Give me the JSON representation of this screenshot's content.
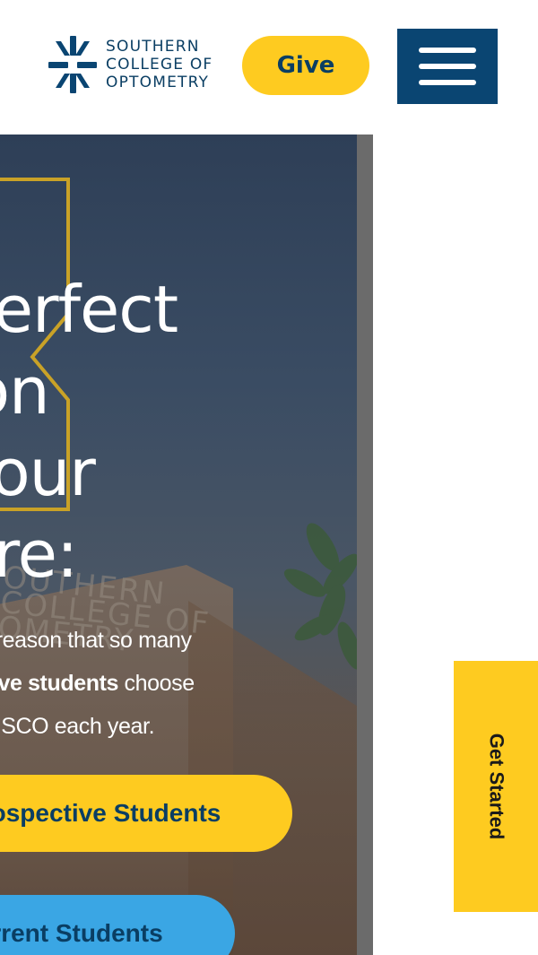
{
  "header": {
    "logo_lines": [
      "SOUTHERN",
      "COLLEGE OF",
      "OPTOMETRY"
    ],
    "give_label": "Give",
    "menu_icon": "hamburger-menu-icon"
  },
  "hero": {
    "headline_lines": [
      "perfect",
      "ion",
      "your",
      "ure:"
    ],
    "intro_line_1": "s a reason that so many",
    "intro_bold": "ective students",
    "intro_line_2_rest": " choose",
    "intro_line_3": "y to SCO each year.",
    "building_sign": [
      "OUTHERN",
      "COLLEGE OF",
      "OMETRY"
    ],
    "cta_prospective": "ospective Students",
    "cta_current": "rrent Students"
  },
  "side_tab": {
    "label": "Get Started"
  },
  "colors": {
    "brand_navy": "#0a3e63",
    "brand_yellow": "#fecb20",
    "brand_blue": "#3aa6e4",
    "menu_bg": "#0a4572"
  }
}
